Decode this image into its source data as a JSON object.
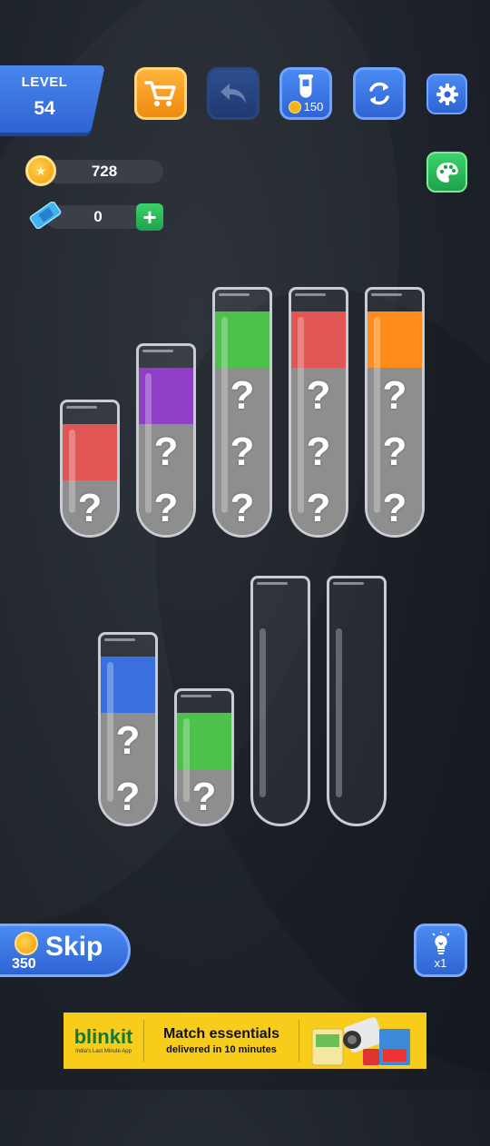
{
  "level": {
    "label": "LEVEL",
    "number": "54"
  },
  "toolbar": {
    "shop_icon": "cart-icon",
    "undo_icon": "undo-arrow-icon",
    "add_tube_icon": "test-tube-icon",
    "add_tube_cost": "150",
    "restart_icon": "refresh-icon",
    "settings_icon": "gear-icon",
    "theme_icon": "palette-icon"
  },
  "wallet": {
    "coins": "728",
    "tickets": "0"
  },
  "tubes": [
    {
      "capacity": 2,
      "segments": [
        {
          "type": "color",
          "color": "#e25555"
        },
        {
          "type": "hidden",
          "label": "?"
        }
      ]
    },
    {
      "capacity": 3,
      "segments": [
        {
          "type": "color",
          "color": "#8e3fc6"
        },
        {
          "type": "hidden",
          "label": "?"
        },
        {
          "type": "hidden",
          "label": "?"
        }
      ]
    },
    {
      "capacity": 4,
      "segments": [
        {
          "type": "color",
          "color": "#4cc24a"
        },
        {
          "type": "hidden",
          "label": "?"
        },
        {
          "type": "hidden",
          "label": "?"
        },
        {
          "type": "hidden",
          "label": "?"
        }
      ]
    },
    {
      "capacity": 4,
      "segments": [
        {
          "type": "color",
          "color": "#e25555"
        },
        {
          "type": "hidden",
          "label": "?"
        },
        {
          "type": "hidden",
          "label": "?"
        },
        {
          "type": "hidden",
          "label": "?"
        }
      ]
    },
    {
      "capacity": 4,
      "segments": [
        {
          "type": "color",
          "color": "#ff8c1a"
        },
        {
          "type": "hidden",
          "label": "?"
        },
        {
          "type": "hidden",
          "label": "?"
        },
        {
          "type": "hidden",
          "label": "?"
        }
      ]
    },
    {
      "capacity": 3,
      "segments": [
        {
          "type": "color",
          "color": "#3a6fe0"
        },
        {
          "type": "hidden",
          "label": "?"
        },
        {
          "type": "hidden",
          "label": "?"
        }
      ]
    },
    {
      "capacity": 2,
      "segments": [
        {
          "type": "color",
          "color": "#4cc24a"
        },
        {
          "type": "hidden",
          "label": "?"
        }
      ]
    },
    {
      "capacity": 4,
      "segments": []
    },
    {
      "capacity": 4,
      "segments": []
    }
  ],
  "skip": {
    "label": "Skip",
    "cost": "350"
  },
  "hint": {
    "icon": "lightbulb-icon",
    "count": "x1"
  },
  "ad": {
    "brand": "blinkit",
    "tagline": "India's Last Minute App",
    "headline": "Match essentials",
    "subline": "delivered in 10 minutes"
  }
}
